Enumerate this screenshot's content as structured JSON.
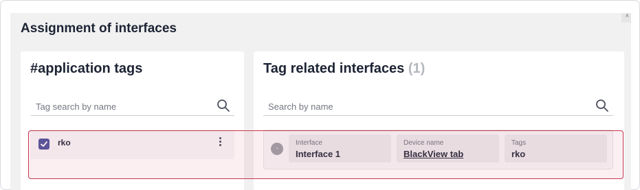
{
  "section": {
    "title": "Assignment of interfaces"
  },
  "tags_panel": {
    "title": "#application tags",
    "search_placeholder": "Tag search by name",
    "items": [
      {
        "label": "rko",
        "checked": true
      }
    ]
  },
  "interfaces_panel": {
    "title": "Tag related interfaces",
    "count": "(1)",
    "search_placeholder": "Search by name",
    "rows": [
      {
        "status": "-",
        "interface_label": "Interface",
        "interface_value": "Interface 1",
        "device_label": "Device name",
        "device_value": "BlackView tab",
        "tags_label": "Tags",
        "tags_value": "rko"
      }
    ]
  },
  "colors": {
    "accent": "#4a4f9a",
    "highlight_border": "#c8354f",
    "background": "#f1f1f1"
  },
  "icons": [
    "search-icon",
    "checkbox-checked-icon",
    "kebab-menu-icon",
    "status-icon"
  ]
}
